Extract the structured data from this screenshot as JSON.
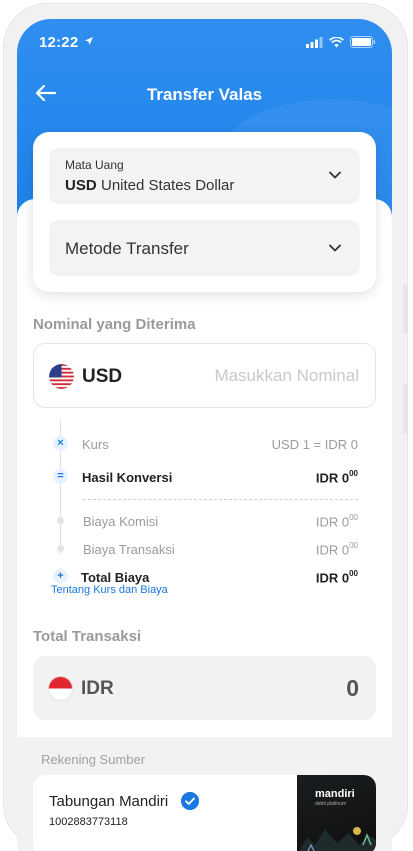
{
  "status_bar": {
    "time": "12:22"
  },
  "nav": {
    "title": "Transfer Valas"
  },
  "currency_select": {
    "label": "Mata Uang",
    "code": "USD",
    "name": "United States Dollar"
  },
  "method_select": {
    "placeholder": "Metode Transfer"
  },
  "received": {
    "section_label": "Nominal yang Diterima",
    "currency_code": "USD",
    "input_placeholder": "Masukkan Nominal"
  },
  "breakdown": {
    "kurs_label": "Kurs",
    "kurs_value": "USD 1 = IDR 0",
    "hasil_label": "Hasil Konversi",
    "hasil_value_main": "IDR 0",
    "hasil_value_dec": "00",
    "komisi_label": "Biaya Komisi",
    "komisi_value_main": "IDR 0",
    "komisi_value_dec": "00",
    "transaksi_label": "Biaya Transaksi",
    "transaksi_value_main": "IDR 0",
    "transaksi_value_dec": "00",
    "total_label": "Total Biaya",
    "total_value_main": "IDR 0",
    "total_value_dec": "00",
    "info_link": "Tentang Kurs dan Biaya"
  },
  "total": {
    "section_label": "Total Transaksi",
    "currency_code": "IDR",
    "value": "0"
  },
  "source": {
    "section_label": "Rekening Sumber",
    "account_name": "Tabungan Mandiri",
    "account_number": "1002883773118",
    "card_brand": "mandiri",
    "card_sub": "debit platinum"
  },
  "colors": {
    "accent": "#1a78e0",
    "header": "#2f8ff0"
  },
  "icons": [
    "location-arrow-icon",
    "signal-icon",
    "wifi-icon",
    "battery-icon",
    "back-arrow-icon",
    "chevron-down-icon",
    "us-flag-icon",
    "id-flag-icon",
    "times-icon",
    "equals-icon",
    "plus-icon",
    "verified-check-icon"
  ]
}
